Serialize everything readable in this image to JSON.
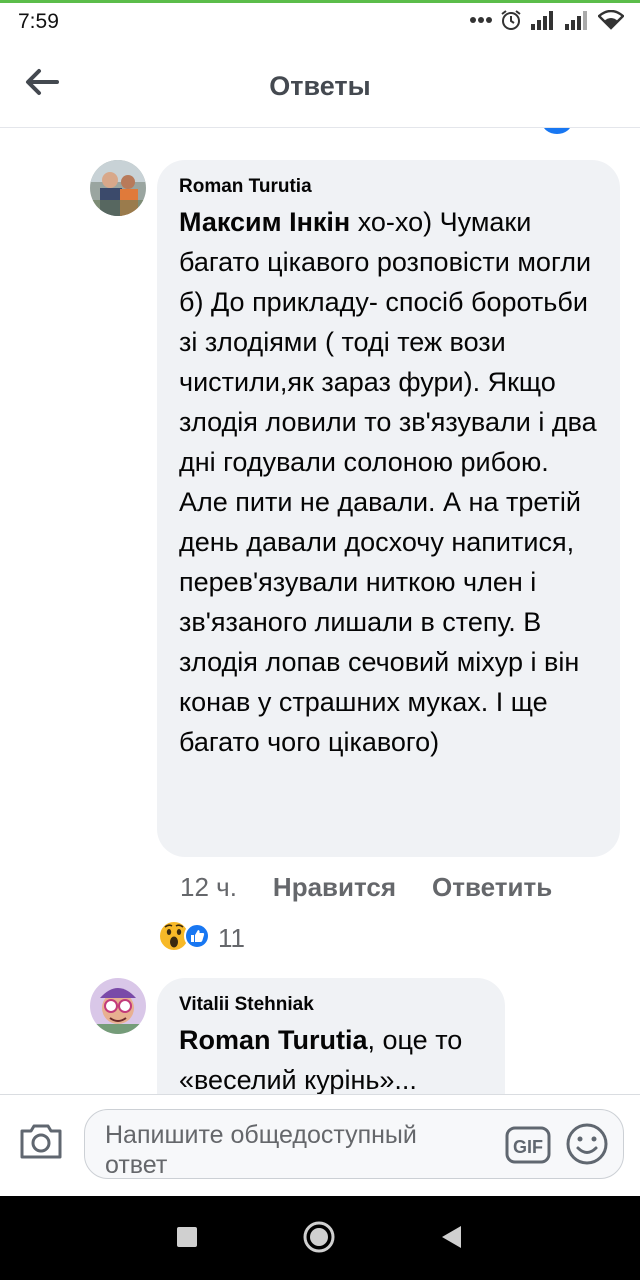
{
  "status_bar": {
    "time": "7:59"
  },
  "header": {
    "title": "Ответы"
  },
  "comments": [
    {
      "author": "Roman Turutia",
      "mention": "Максим Інкін",
      "text": " хо-хо) Чумаки багато цікавого розповісти могли б) До прикладу- спосіб боротьби зі злодіями ( тоді теж вози чистили,як зараз фури). Якщо злодія ловили то зв'язували і два дні годували солоною рибою. Але пити не давали. А на третій день давали досхочу напитися, перев'язували ниткою член і зв'язаного лишали в степу. В злодія лопав сечовий міхур і він конав у страшних муках. І ще багато чого цікавого)",
      "time": "12 ч.",
      "like_label": "Нравится",
      "reply_label": "Ответить",
      "reaction_count": "11",
      "reaction_icons": [
        "wow-icon",
        "like-icon"
      ]
    },
    {
      "author": "Vitalii Stehniak",
      "mention": "Roman Turutia",
      "text": ", оце то «веселий курінь»..."
    }
  ],
  "composer": {
    "placeholder": "Напишите общедоступный ответ"
  },
  "colors": {
    "accent": "#1877f2",
    "bubble": "#f0f2f5",
    "meta": "#65676b",
    "status_line": "#5bbd4a"
  }
}
